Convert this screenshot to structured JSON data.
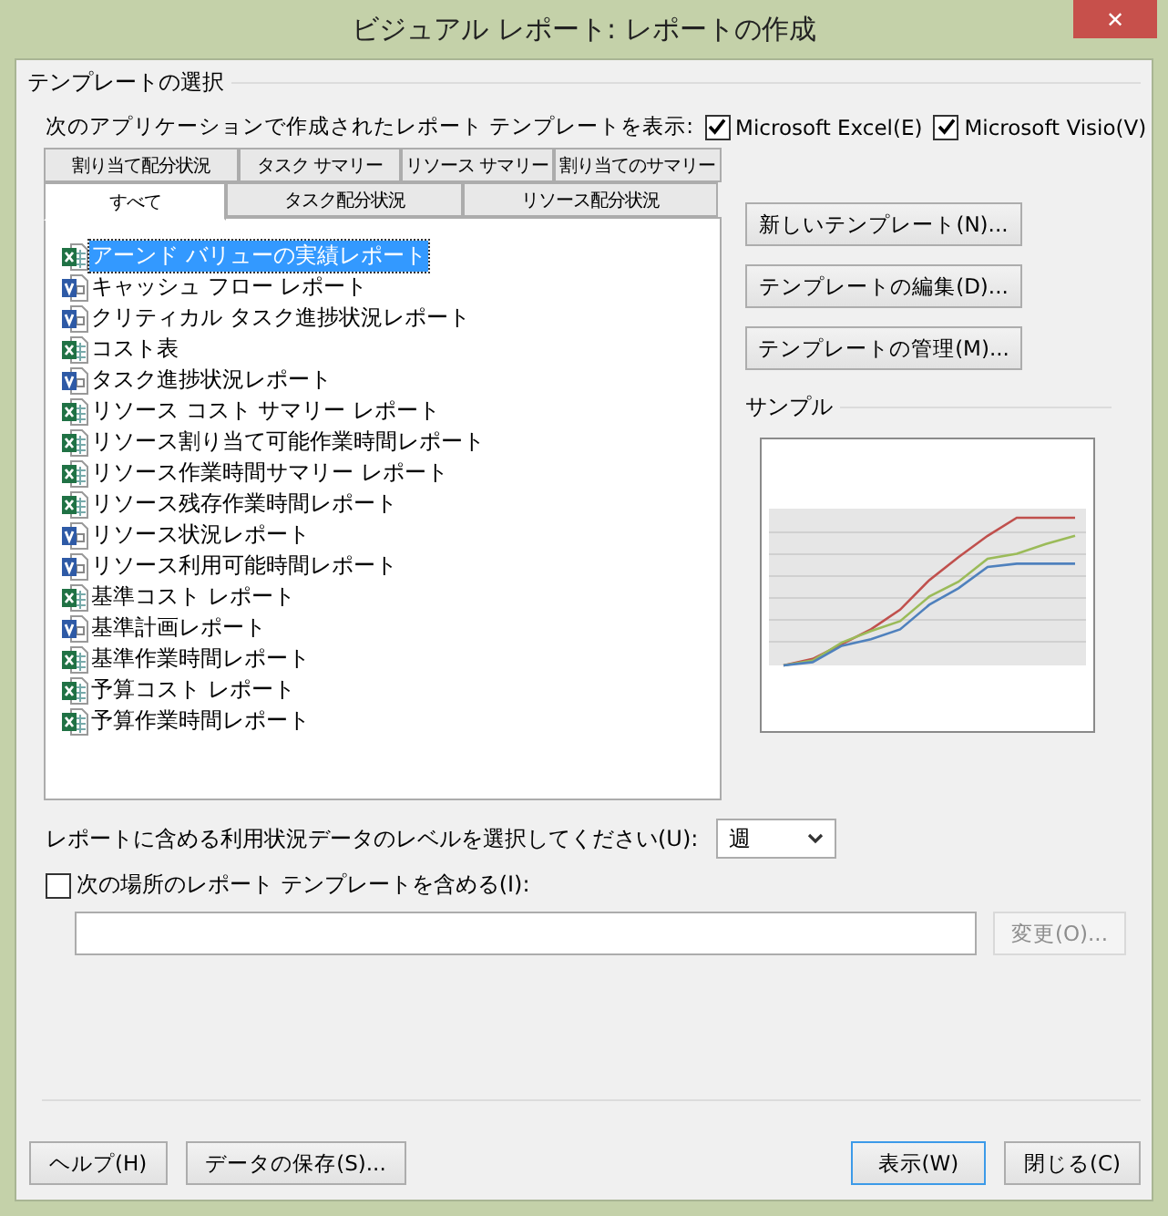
{
  "window": {
    "title": "ビジュアル レポート: レポートの作成",
    "close_label": "✕"
  },
  "template_group": {
    "title": "テンプレートの選択",
    "show_label": "次のアプリケーションで作成されたレポート テンプレートを表示:",
    "filters": [
      {
        "label": "Microsoft Excel(E)",
        "checked": true
      },
      {
        "label": "Microsoft Visio(V)",
        "checked": true
      }
    ],
    "tab_rows": [
      [
        {
          "label": "割り当て配分状況",
          "selected": false
        },
        {
          "label": "タスク サマリー",
          "selected": false
        },
        {
          "label": "リソース サマリー",
          "selected": false
        },
        {
          "label": "割り当てのサマリー",
          "selected": false
        }
      ],
      [
        {
          "label": "すべて",
          "selected": true
        },
        {
          "label": "タスク配分状況",
          "selected": false
        },
        {
          "label": "リソース配分状況",
          "selected": false
        }
      ]
    ],
    "reports": [
      {
        "label": "アーンド バリューの実績レポート",
        "kind": "excel",
        "selected": true
      },
      {
        "label": "キャッシュ フロー レポート",
        "kind": "visio",
        "selected": false
      },
      {
        "label": "クリティカル タスク進捗状況レポート",
        "kind": "visio",
        "selected": false
      },
      {
        "label": "コスト表",
        "kind": "excel",
        "selected": false
      },
      {
        "label": "タスク進捗状況レポート",
        "kind": "visio",
        "selected": false
      },
      {
        "label": "リソース コスト サマリー レポート",
        "kind": "excel",
        "selected": false
      },
      {
        "label": "リソース割り当て可能作業時間レポート",
        "kind": "excel",
        "selected": false
      },
      {
        "label": "リソース作業時間サマリー レポート",
        "kind": "excel",
        "selected": false
      },
      {
        "label": "リソース残存作業時間レポート",
        "kind": "excel",
        "selected": false
      },
      {
        "label": "リソース状況レポート",
        "kind": "visio",
        "selected": false
      },
      {
        "label": "リソース利用可能時間レポート",
        "kind": "visio",
        "selected": false
      },
      {
        "label": "基準コスト レポート",
        "kind": "excel",
        "selected": false
      },
      {
        "label": "基準計画レポート",
        "kind": "visio",
        "selected": false
      },
      {
        "label": "基準作業時間レポート",
        "kind": "excel",
        "selected": false
      },
      {
        "label": "予算コスト レポート",
        "kind": "excel",
        "selected": false
      },
      {
        "label": "予算作業時間レポート",
        "kind": "excel",
        "selected": false
      }
    ],
    "buttons": [
      "新しいテンプレート(N)...",
      "テンプレートの編集(D)...",
      "テンプレートの管理(M)..."
    ],
    "sample_title": "サンプル"
  },
  "level": {
    "label": "レポートに含める利用状況データのレベルを選択してください(U):",
    "value": "週"
  },
  "include": {
    "label": "次の場所のレポート テンプレートを含める(I):",
    "checked": false,
    "change_button": "変更(O)...",
    "disabled": true
  },
  "footer": {
    "left": [
      "ヘルプ(H)",
      "データの保存(S)..."
    ],
    "right": [
      {
        "label": "表示(W)",
        "default": true
      },
      {
        "label": "閉じる(C)",
        "default": false
      }
    ]
  }
}
